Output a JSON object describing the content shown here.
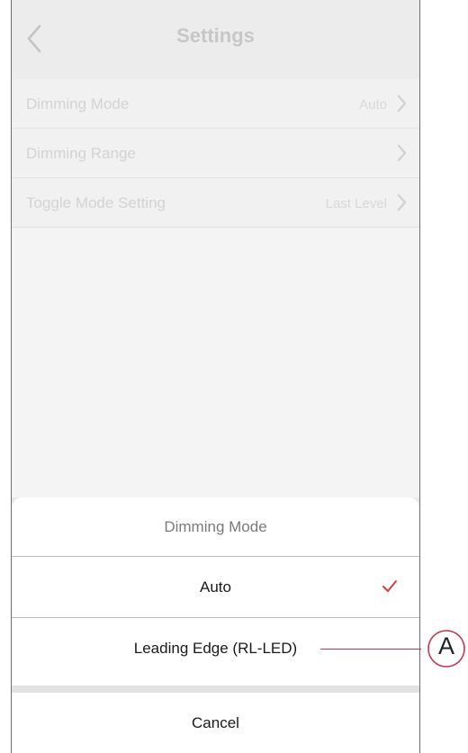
{
  "header": {
    "title": "Settings",
    "back_icon": "chevron-left-icon"
  },
  "settings": [
    {
      "label": "Dimming Mode",
      "value": "Auto"
    },
    {
      "label": "Dimming Range",
      "value": ""
    },
    {
      "label": "Toggle Mode Setting",
      "value": "Last Level"
    }
  ],
  "action_sheet": {
    "title": "Dimming Mode",
    "options": [
      {
        "label": "Auto",
        "selected": true
      },
      {
        "label": "Leading Edge (RL-LED)",
        "selected": false
      }
    ],
    "cancel_label": "Cancel"
  },
  "callout": {
    "letter": "A"
  },
  "colors": {
    "check": "#e2363f",
    "callout": "#c0394e"
  }
}
